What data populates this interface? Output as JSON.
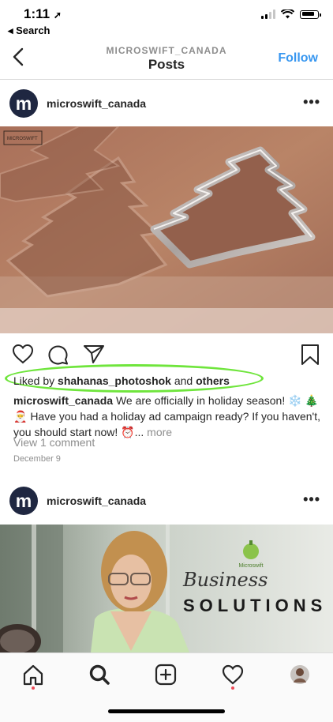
{
  "status_bar": {
    "time": "1:11",
    "back_label": "◂ Search"
  },
  "header": {
    "subtitle": "MICROSWIFT_CANADA",
    "title": "Posts",
    "follow_label": "Follow"
  },
  "posts": [
    {
      "username": "microswift_canada",
      "avatar_letter": "m",
      "watermark": "MICROSWIFT",
      "likes": {
        "prefix": "Liked by ",
        "user": "shahanas_photoshok",
        "middle": " and ",
        "others": "others"
      },
      "caption": {
        "username": "microswift_canada",
        "text": " We are officially in holiday season! ❄️ 🎄 🎅 Have you had a holiday ad campaign ready? If you haven't, you should start now! ⏰...",
        "more": " more"
      },
      "view_comments": "View 1 comment",
      "date": "December 9"
    },
    {
      "username": "microswift_canada",
      "avatar_letter": "m",
      "logo_text": "Microswift",
      "script_text": "Business",
      "headline": "SOLUTIONS"
    }
  ],
  "tabbar": {
    "items": [
      "home-icon",
      "search-icon",
      "add-icon",
      "heart-icon",
      "profile-icon"
    ]
  },
  "colors": {
    "accent": "#3897f0",
    "highlight": "#6fe53c",
    "notification": "#ed4956"
  }
}
